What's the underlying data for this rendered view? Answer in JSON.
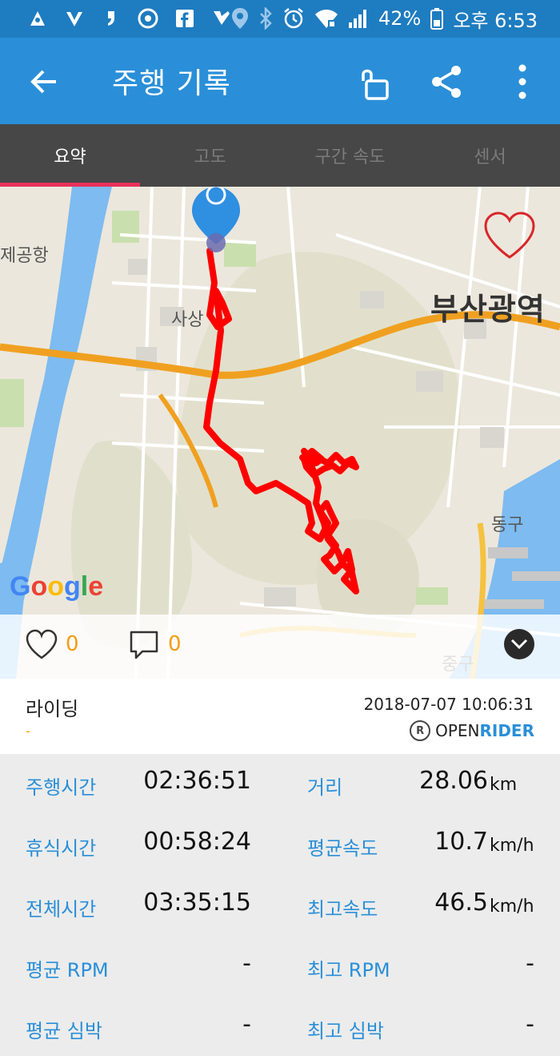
{
  "status_bar": {
    "left_icons": [
      "notification-icon",
      "v-app-icon",
      "apostrophe-app-icon",
      "chrome-icon",
      "facebook-icon",
      "check-app-icon"
    ],
    "right_icons": [
      "location-icon",
      "bluetooth-icon",
      "alarm-icon",
      "wifi-icon",
      "signal-icon"
    ],
    "battery": "42%",
    "time": "오후 6:53"
  },
  "app_bar": {
    "title": "주행 기록",
    "icons": [
      "back-arrow-icon",
      "unlock-icon",
      "share-icon",
      "more-vert-icon"
    ]
  },
  "tabs": [
    {
      "label": "요약",
      "active": true
    },
    {
      "label": "고도",
      "active": false
    },
    {
      "label": "구간 속도",
      "active": false
    },
    {
      "label": "센서",
      "active": false
    }
  ],
  "map": {
    "labels": {
      "airport": "제공항",
      "sasang": "사상",
      "busan": "부산광역",
      "donggu": "동구",
      "junggu": "중구"
    },
    "google_logo": "Google",
    "route_color": "#ff0000",
    "road_color": "#f0a020",
    "water_color": "#7dbbf0"
  },
  "social": {
    "likes": "0",
    "comments": "0"
  },
  "ride_info": {
    "type": "라이딩",
    "subtitle": "-",
    "datetime": "2018-07-07 10:06:31",
    "brand_open": "OPEN",
    "brand_rider": "RIDER"
  },
  "stats": {
    "row1": {
      "label_left": "주행시간",
      "value_left": "02:36:51",
      "label_right": "거리",
      "value_right": "28.06",
      "unit_right": "km"
    },
    "row2": {
      "label_left": "휴식시간",
      "value_left": "00:58:24",
      "label_right": "평균속도",
      "value_right": "10.7",
      "unit_right": "km/h"
    },
    "row3": {
      "label_left": "전체시간",
      "value_left": "03:35:15",
      "label_right": "최고속도",
      "value_right": "46.5",
      "unit_right": "km/h"
    },
    "row4": {
      "label_left": "평균 RPM",
      "value_left": "-",
      "label_right": "최고 RPM",
      "value_right": "-"
    },
    "row5": {
      "label_left": "평균 심박",
      "value_left": "-",
      "label_right": "최고 심박",
      "value_right": "-"
    }
  },
  "colors": {
    "status_bar": "#1e7cc0",
    "app_bar": "#2a8fd8",
    "tab_bg": "#474747",
    "tab_indicator": "#e8325a",
    "label_blue": "#2a8fd8",
    "count_orange": "#f39c12"
  }
}
